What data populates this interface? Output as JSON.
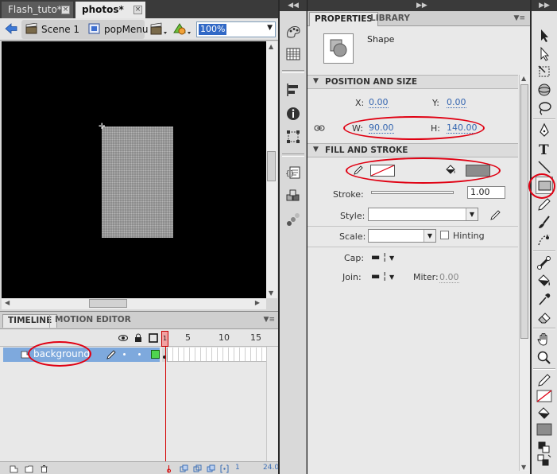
{
  "document": {
    "tabs": [
      {
        "label": "Flash_tuto*",
        "active": false
      },
      {
        "label": "photos*",
        "active": true
      }
    ],
    "breadcrumbs": [
      "Scene 1",
      "popMenu"
    ],
    "zoom": "100%"
  },
  "stage": {
    "background": "#000000",
    "shape_fill": "#8c8c8c"
  },
  "timeline": {
    "tabs": [
      "TIMELINE",
      "MOTION EDITOR"
    ],
    "frame_numbers": [
      "1",
      "5",
      "10",
      "15"
    ],
    "layers": [
      {
        "name": "background",
        "color": "#4fd44f"
      }
    ],
    "current_frame": "1",
    "fps": "24.0"
  },
  "properties": {
    "tabs": [
      "PROPERTIES",
      "LIBRARY"
    ],
    "object_type": "Shape",
    "sections": {
      "position_size": "POSITION AND SIZE",
      "fill_stroke": "FILL AND STROKE"
    },
    "position": {
      "x_label": "X:",
      "x": "0.00",
      "y_label": "Y:",
      "y": "0.00"
    },
    "size": {
      "w_label": "W:",
      "w": "90.00",
      "h_label": "H:",
      "h": "140.00"
    },
    "stroke": {
      "label": "Stroke:",
      "value": "1.00"
    },
    "style": {
      "label": "Style:"
    },
    "scale": {
      "label": "Scale:",
      "hinting_label": "Hinting"
    },
    "cap": {
      "label": "Cap:"
    },
    "join": {
      "label": "Join:",
      "miter_label": "Miter:",
      "miter": "0.00"
    },
    "fill_color": "#8c8c8c",
    "highlight_color": "#e00012"
  }
}
